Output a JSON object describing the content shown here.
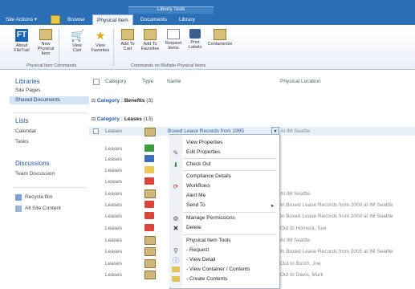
{
  "ribbon": {
    "context_tab": "Library Tools",
    "site_actions": "Site Actions ▾",
    "tabs": [
      "Browse",
      "Physical Item",
      "Documents",
      "Library"
    ],
    "buttons": [
      {
        "label": "About\nFileTrail",
        "icon": "filetrail-logo-icon"
      },
      {
        "label": "New Physical\nItem",
        "icon": "new-item-icon"
      },
      {
        "label": "View\nCart",
        "icon": "cart-icon"
      },
      {
        "label": "View\nFavorites",
        "icon": "favorites-icon"
      },
      {
        "label": "Add To\nCart",
        "icon": "add-cart-icon"
      },
      {
        "label": "Add To\nFavorites",
        "icon": "add-favorites-icon"
      },
      {
        "label": "Request\nItems",
        "icon": "request-icon"
      },
      {
        "label": "Print\nLabels",
        "icon": "printer-icon"
      },
      {
        "label": "Containerize",
        "icon": "containerize-icon"
      }
    ],
    "group_labels": [
      "Physical Item Commands",
      "Commands on Multiple Physical Items"
    ]
  },
  "sidebar": {
    "libraries": "Libraries",
    "site_pages": "Site Pages",
    "shared_documents": "Shared Documents",
    "lists": "Lists",
    "calendar": "Calendar",
    "tasks": "Tasks",
    "discussions": "Discussions",
    "team_discussion": "Team Discussion",
    "recycle_bin": "Recycle Bin",
    "all_site_content": "All Site Content"
  },
  "list": {
    "headers": {
      "category": "Category",
      "type": "Type",
      "name": "Name",
      "location": "Physical Location"
    },
    "group_benefits": {
      "label": "Category :",
      "value": "Benefits",
      "count": "(3)"
    },
    "group_leases": {
      "label": "Category :",
      "value": "Leases",
      "count": "(13)"
    },
    "first_row": {
      "category": "Leases",
      "name": "Boxed Lease Records from 1995",
      "location": "At IM Seattle"
    },
    "category_value": "Leases",
    "locations": [
      "At IM Seattle",
      "In Boxed Lease Records from 2000 at IM Seattle",
      "In Boxed Lease Records from 2000 at IM Seattle",
      "Out to Homera, Sue",
      "At IM Seattle",
      "In Boxed Lease Records from 2005 at IM Seattle",
      "Out to Burch, Joe",
      "Out to Davis, Mark"
    ]
  },
  "menu": {
    "items": [
      {
        "label": "View Properties",
        "icon": "view-properties-icon"
      },
      {
        "label": "Edit Properties",
        "icon": "edit-properties-icon"
      },
      {
        "label": "Check Out",
        "icon": "check-out-icon"
      },
      {
        "label": "Compliance Details",
        "icon": ""
      },
      {
        "label": "Workflows",
        "icon": "workflows-icon"
      },
      {
        "label": "Alert Me",
        "icon": ""
      },
      {
        "label": "Send To",
        "icon": ""
      },
      {
        "label": "Manage Permissions",
        "icon": "permissions-icon"
      },
      {
        "label": "Delete",
        "icon": "delete-icon"
      },
      {
        "label": "Physical Item Tools",
        "icon": ""
      },
      {
        "label": "- Request",
        "icon": "request-icon"
      },
      {
        "label": "- View Detail",
        "icon": "view-detail-icon"
      },
      {
        "label": "- View Container / Contents",
        "icon": "container-icon"
      },
      {
        "label": "- Create Contents",
        "icon": "create-contents-icon"
      }
    ],
    "send_to_arrow": "▸"
  },
  "colors": {
    "ribbon": "#2b6fb6",
    "link": "#1f5aa0",
    "selected": "#d3e4f7"
  }
}
